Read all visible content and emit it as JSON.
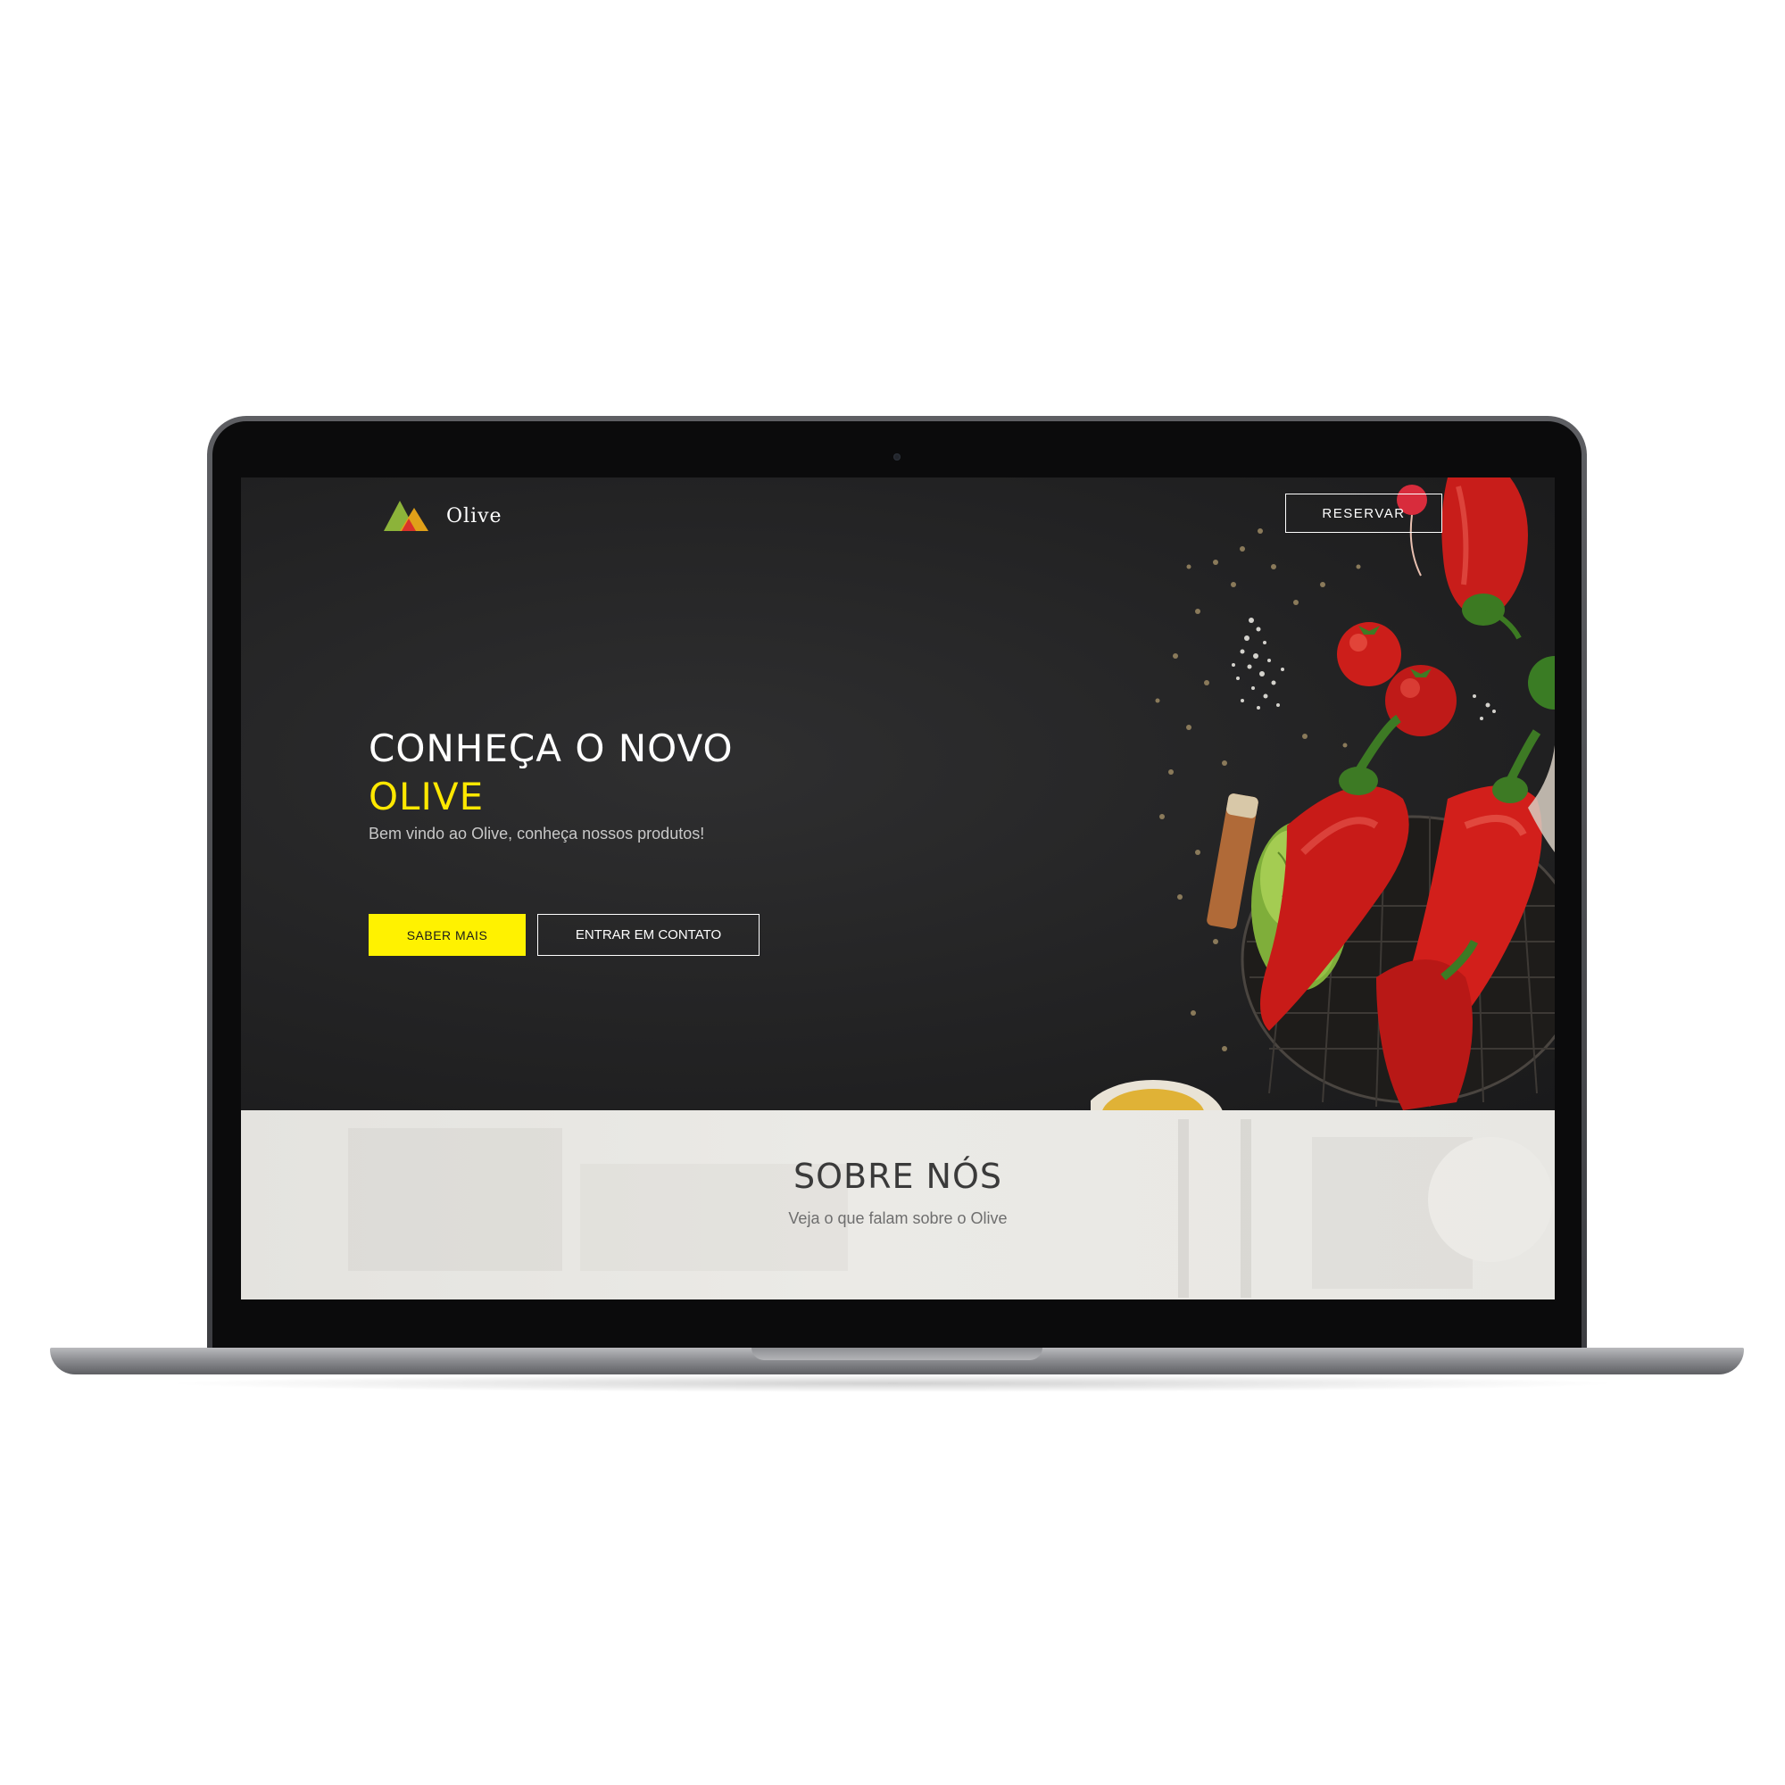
{
  "brand": {
    "name": "Olive",
    "logo_colors": [
      "#8cb33a",
      "#e0a019",
      "#d9322a"
    ]
  },
  "header": {
    "reserve_label": "RESERVAR"
  },
  "hero": {
    "title_line1": "CONHEÇA O NOVO",
    "title_line2": "OLIVE",
    "subtitle": "Bem vindo ao Olive, conheça nossos produtos!",
    "primary_button": "SABER MAIS",
    "secondary_button": "ENTRAR EM CONTATO",
    "accent_color": "#fff200"
  },
  "about": {
    "title": "SOBRE NÓS",
    "subtitle": "Veja o que falam sobre o Olive"
  }
}
